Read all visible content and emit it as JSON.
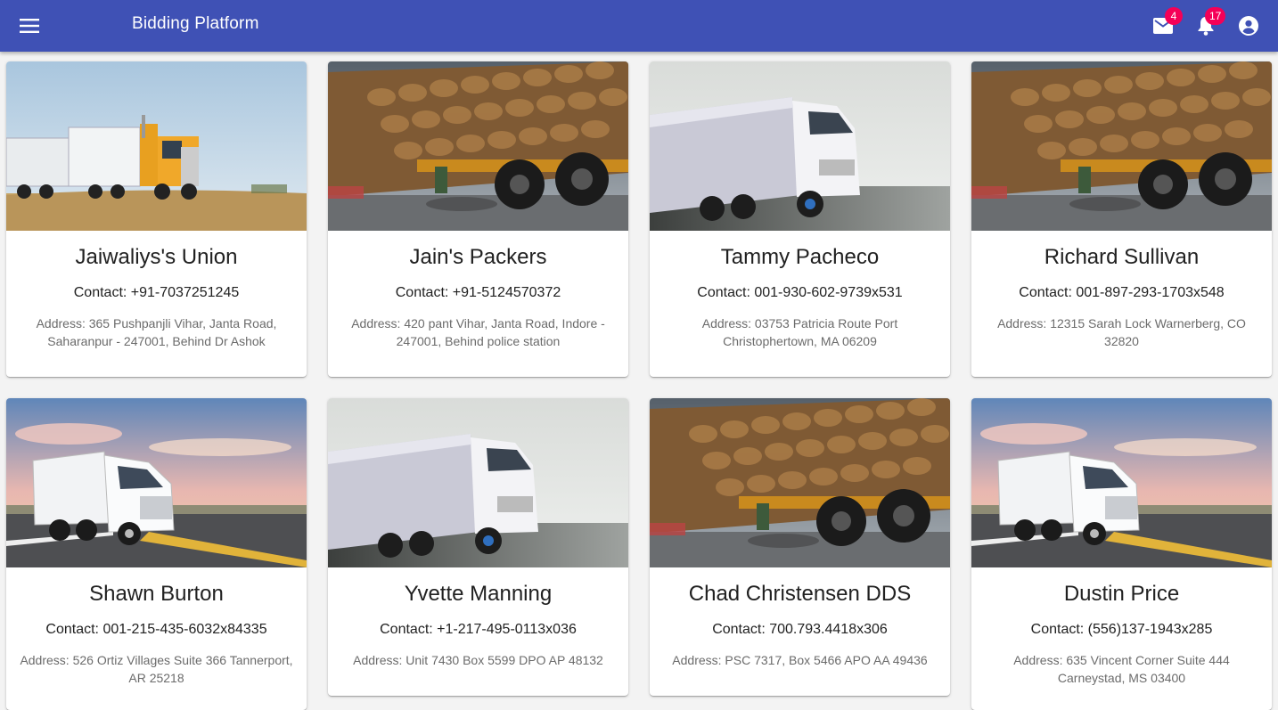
{
  "app": {
    "title": "Bidding Platform",
    "menu_icon": "menu-icon",
    "mail_icon": "mail-icon",
    "mail_badge": "4",
    "notifications_icon": "bell-icon",
    "notifications_badge": "17",
    "account_icon": "account-circle-icon"
  },
  "colors": {
    "appbar": "#3f51b5",
    "badge": "#f50057",
    "background": "#f3f3f3"
  },
  "cards": [
    {
      "name": "Jaiwaliys's Union",
      "contact": "Contact: +91-7037251245",
      "address": "Address: 365 Pushpanjli Vihar, Janta Road, Saharanpur - 247001, Behind Dr Ashok",
      "image": "road-train-truck-photo"
    },
    {
      "name": "Jain's Packers",
      "contact": "Contact: +91-5124570372",
      "address": "Address: 420 pant Vihar, Janta Road, Indore - 247001, Behind police station",
      "image": "loaded-sack-truck-photo"
    },
    {
      "name": "Tammy Pacheco",
      "contact": "Contact: 001-930-602-9739x531",
      "address": "Address: 03753 Patricia Route Port Christophertown, MA 06209",
      "image": "white-truck-motion-photo"
    },
    {
      "name": "Richard Sullivan",
      "contact": "Contact: 001-897-293-1703x548",
      "address": "Address: 12315 Sarah Lock Warnerberg, CO 32820",
      "image": "loaded-sack-truck-photo"
    },
    {
      "name": "Shawn Burton",
      "contact": "Contact: 001-215-435-6032x84335",
      "address": "Address: 526 Ortiz Villages Suite 366 Tannerport, AR 25218",
      "image": "white-semi-truck-sunset-photo"
    },
    {
      "name": "Yvette Manning",
      "contact": "Contact: +1-217-495-0113x036",
      "address": "Address: Unit 7430 Box 5599 DPO AP 48132",
      "image": "white-truck-motion-photo"
    },
    {
      "name": "Chad Christensen DDS",
      "contact": "Contact: 700.793.4418x306",
      "address": "Address: PSC 7317, Box 5466 APO AA 49436",
      "image": "loaded-sack-truck-photo"
    },
    {
      "name": "Dustin Price",
      "contact": "Contact: (556)137-1943x285",
      "address": "Address: 635 Vincent Corner Suite 444 Carneystad, MS 03400",
      "image": "white-semi-truck-sunset-photo"
    }
  ]
}
